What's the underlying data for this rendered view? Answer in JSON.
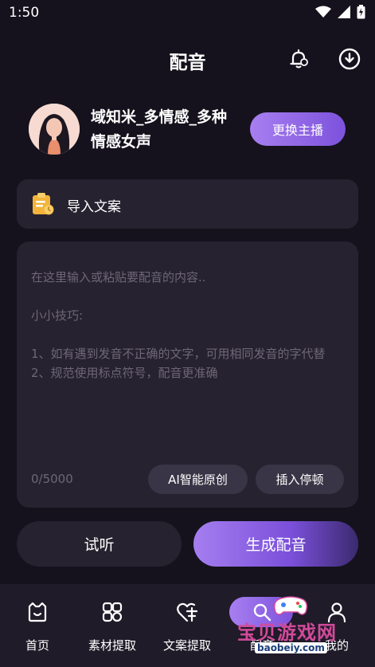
{
  "status_bar": {
    "time": "1:50"
  },
  "header": {
    "title": "配音"
  },
  "voice": {
    "name": "域知米_多情感_多种情感女声",
    "change_button": "更换主播"
  },
  "import": {
    "label": "导入文案"
  },
  "editor": {
    "placeholder": "在这里输入或粘贴要配音的内容..\n\n小小技巧:\n\n1、如有遇到发音不正确的文字，可用相同发音的字代替\n2、规范使用标点符号，配音更准确",
    "char_count": "0/5000",
    "ai_button": "AI智能原创",
    "pause_button": "插入停顿"
  },
  "actions": {
    "preview": "试听",
    "generate": "生成配音"
  },
  "tab_bar": {
    "tabs": [
      {
        "label": "首页",
        "icon": "home-icon"
      },
      {
        "label": "素材提取",
        "icon": "material-icon"
      },
      {
        "label": "文案提取",
        "icon": "text-extract-icon"
      },
      {
        "label": "配音",
        "icon": "dubbing-icon",
        "active": true
      },
      {
        "label": "我的",
        "icon": "profile-icon"
      }
    ]
  },
  "watermark": {
    "text": "宝贝游戏网",
    "url": "baobeiy.com"
  },
  "colors": {
    "background": "#15121d",
    "card": "#26222f",
    "accent_start": "#a77ff0",
    "accent_end": "#7d52dc"
  }
}
